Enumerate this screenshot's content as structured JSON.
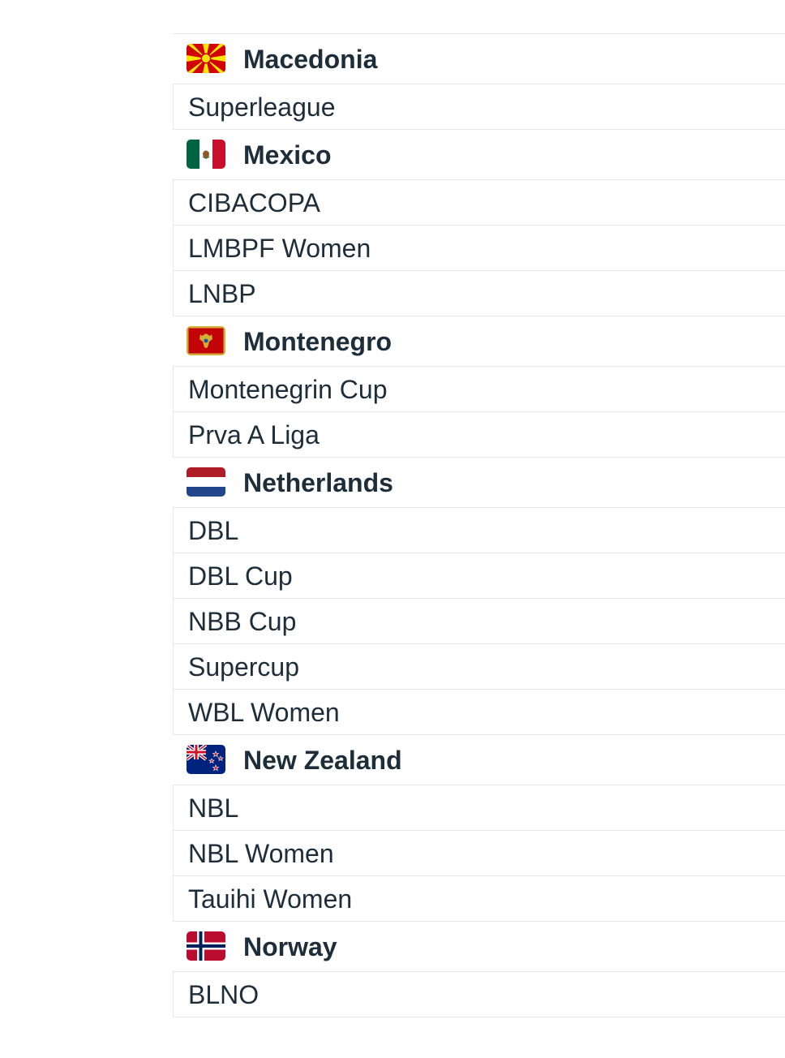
{
  "groups": [
    {
      "country": "Macedonia",
      "flag": "macedonia-flag",
      "leagues": [
        "Superleague"
      ]
    },
    {
      "country": "Mexico",
      "flag": "mexico-flag",
      "leagues": [
        "CIBACOPA",
        "LMBPF Women",
        "LNBP"
      ]
    },
    {
      "country": "Montenegro",
      "flag": "montenegro-flag",
      "leagues": [
        "Montenegrin Cup",
        "Prva A Liga"
      ]
    },
    {
      "country": "Netherlands",
      "flag": "netherlands-flag",
      "leagues": [
        "DBL",
        "DBL Cup",
        "NBB Cup",
        "Supercup",
        "WBL Women"
      ]
    },
    {
      "country": "New Zealand",
      "flag": "new-zealand-flag",
      "leagues": [
        "NBL",
        "NBL Women",
        "Tauihi Women"
      ]
    },
    {
      "country": "Norway",
      "flag": "norway-flag",
      "leagues": [
        "BLNO"
      ]
    }
  ],
  "colors": {
    "text": "#1d2d3a",
    "divider": "#e6e9ec",
    "background": "#ffffff"
  }
}
